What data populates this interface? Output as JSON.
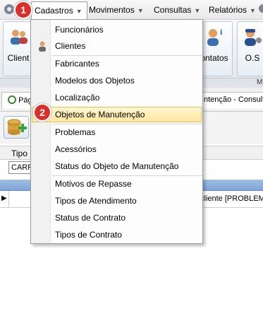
{
  "menubar": {
    "items": [
      {
        "label": "Cadastros"
      },
      {
        "label": "Movimentos"
      },
      {
        "label": "Consultas"
      },
      {
        "label": "Relatórios"
      }
    ]
  },
  "ribbon": {
    "buttons": [
      {
        "label": "Client"
      },
      {
        "label": "ontatos"
      },
      {
        "label": "O.S"
      }
    ],
    "group_right_label": "M"
  },
  "tabs": {
    "left_label": "Pág",
    "right_label": "ntenção - Consult"
  },
  "grid": {
    "filter_column": "Tipo",
    "filter_value": "CARR",
    "row_text": "cliente [PROBLEMA"
  },
  "dropdown": {
    "items": [
      {
        "label": "Funcionários"
      },
      {
        "label": "Clientes"
      },
      {
        "label": "Fabricantes"
      },
      {
        "label": "Modelos dos Objetos"
      },
      {
        "label": "Localização"
      },
      {
        "label": "Objetos de Manutenção"
      },
      {
        "label": "Problemas"
      },
      {
        "label": "Acessórios"
      },
      {
        "label": "Status do Objeto de Manutenção"
      },
      {
        "label": "Motivos de Repasse"
      },
      {
        "label": "Tipos de Atendimento"
      },
      {
        "label": "Status de Contrato"
      },
      {
        "label": "Tipos de Contrato"
      }
    ]
  },
  "badges": [
    "1",
    "2"
  ],
  "colors": {
    "badge": "#d9302c",
    "highlight": "#ffe7a0",
    "grid_header": "#8fb2df"
  },
  "icons": [
    "gear-icon",
    "client-icon",
    "contacts-icon",
    "os-icon",
    "add-database-icon",
    "chevron-down-icon"
  ]
}
